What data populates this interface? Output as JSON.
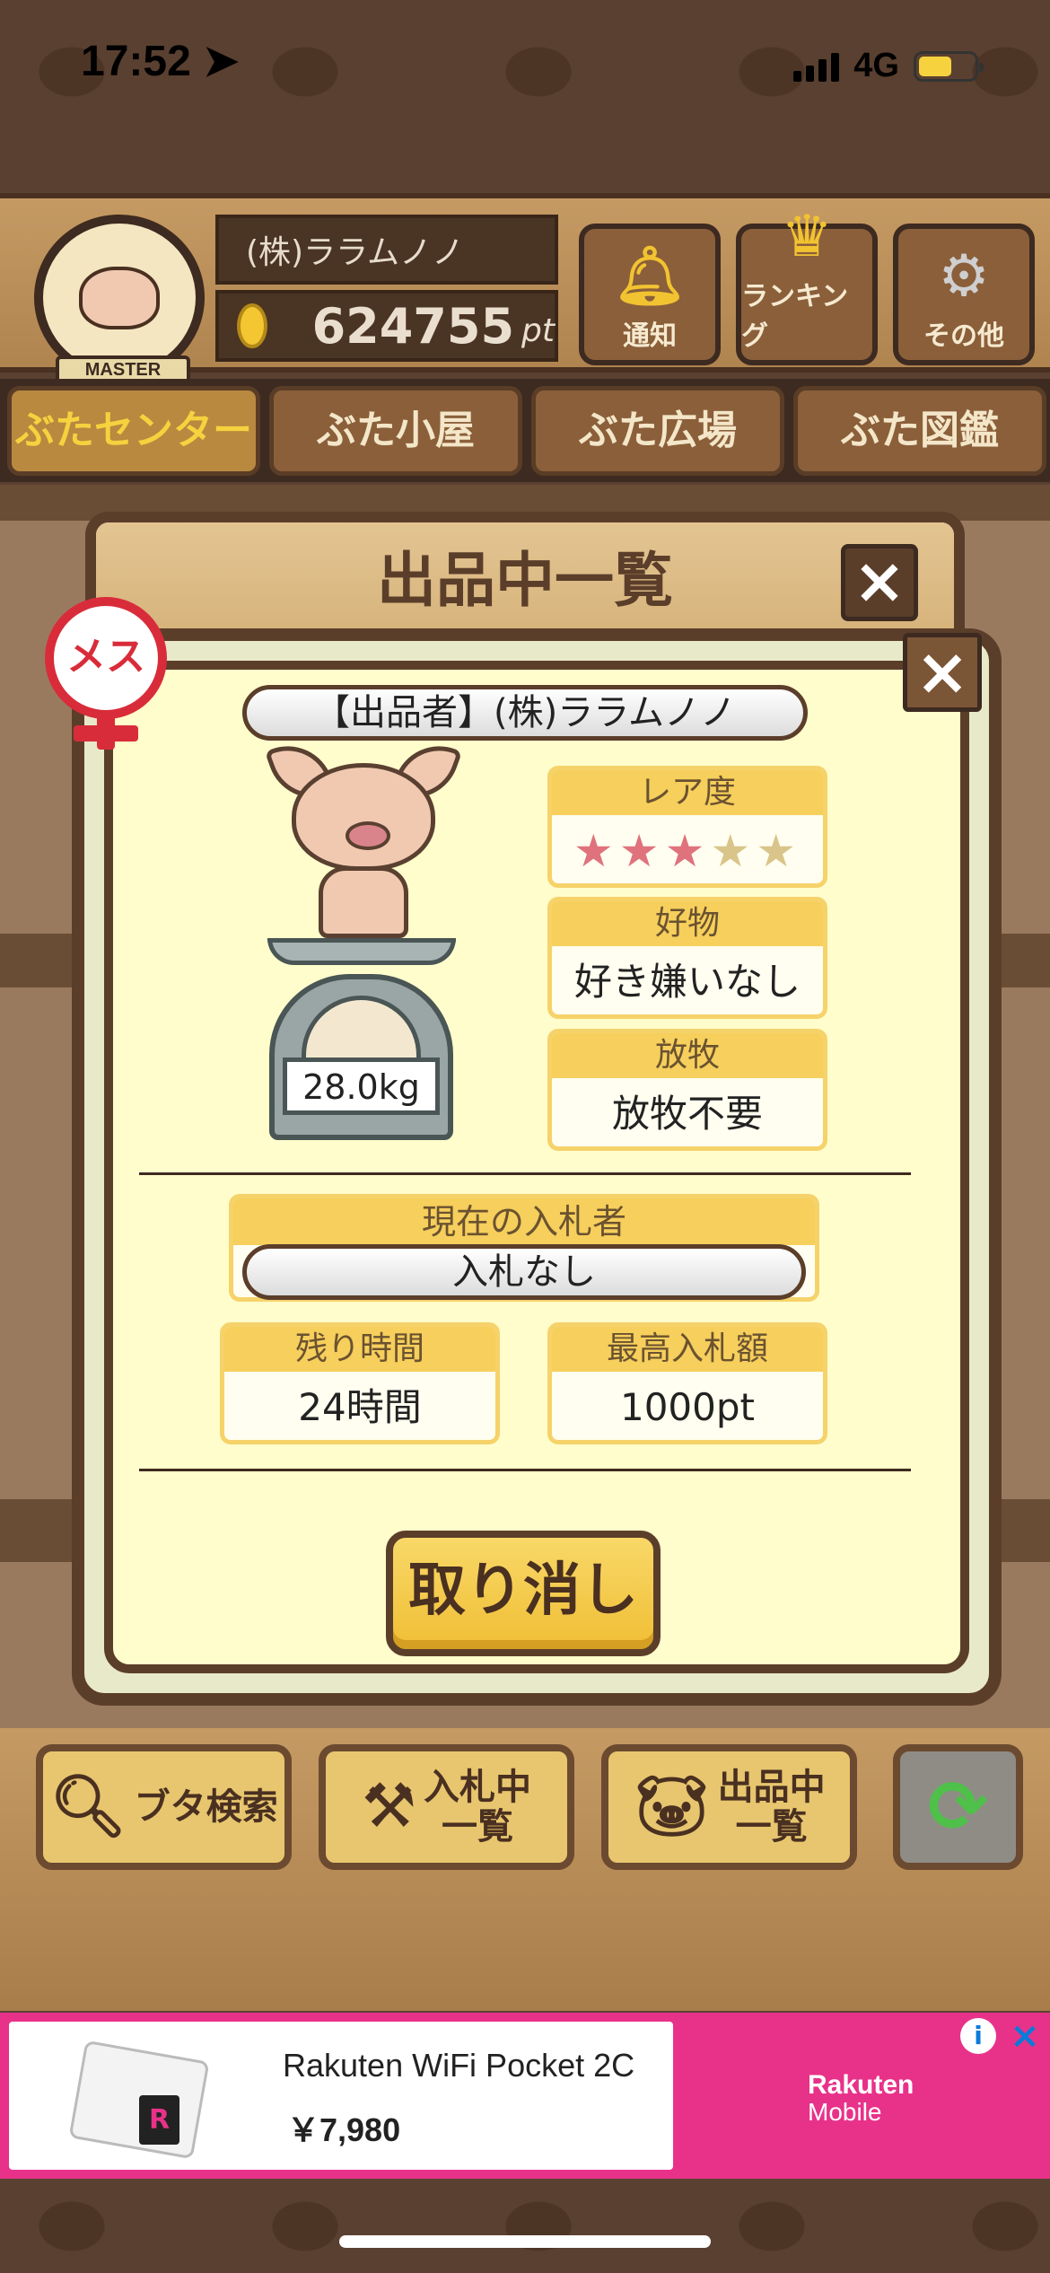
{
  "status_bar": {
    "time": "17:52",
    "network": "4G"
  },
  "header": {
    "avatar_badge": "MASTER",
    "user_name": "(株)ララムノノ",
    "points": "624755",
    "points_unit": "pt",
    "buttons": {
      "notice": "通知",
      "ranking": "ランキング",
      "other": "その他"
    }
  },
  "nav": {
    "tabs": [
      "ぶたセンター",
      "ぶた小屋",
      "ぶた広場",
      "ぶた図鑑"
    ],
    "active_index": 0
  },
  "back_panel": {
    "title": "出品中一覧"
  },
  "modal": {
    "gender_badge": "メス",
    "seller": "【出品者】(株)ララムノノ",
    "weight": "28.0kg",
    "rarity": {
      "label": "レア度",
      "filled": 3,
      "total": 5
    },
    "favorite": {
      "label": "好物",
      "value": "好き嫌いなし"
    },
    "grazing": {
      "label": "放牧",
      "value": "放牧不要"
    },
    "current_bidder": {
      "label": "現在の入札者",
      "value": "入札なし"
    },
    "remaining_time": {
      "label": "残り時間",
      "value": "24時間"
    },
    "highest_bid": {
      "label": "最高入札額",
      "value": "1000pt"
    },
    "cancel_label": "取り消し"
  },
  "toolbar": {
    "search": "ブタ検索",
    "bids_line1": "入札中",
    "bids_line2": "一覧",
    "listed_line1": "出品中",
    "listed_line2": "一覧"
  },
  "ad": {
    "title": "Rakuten WiFi Pocket 2C",
    "price": "￥7,980",
    "brand_line1": "Rakuten",
    "brand_line2": "Mobile",
    "device_mark": "R"
  },
  "colors": {
    "accent": "#f6cf5c",
    "wood_dark": "#5b3e2a",
    "female": "#d92c3a",
    "ad_bg": "#e8328a"
  }
}
